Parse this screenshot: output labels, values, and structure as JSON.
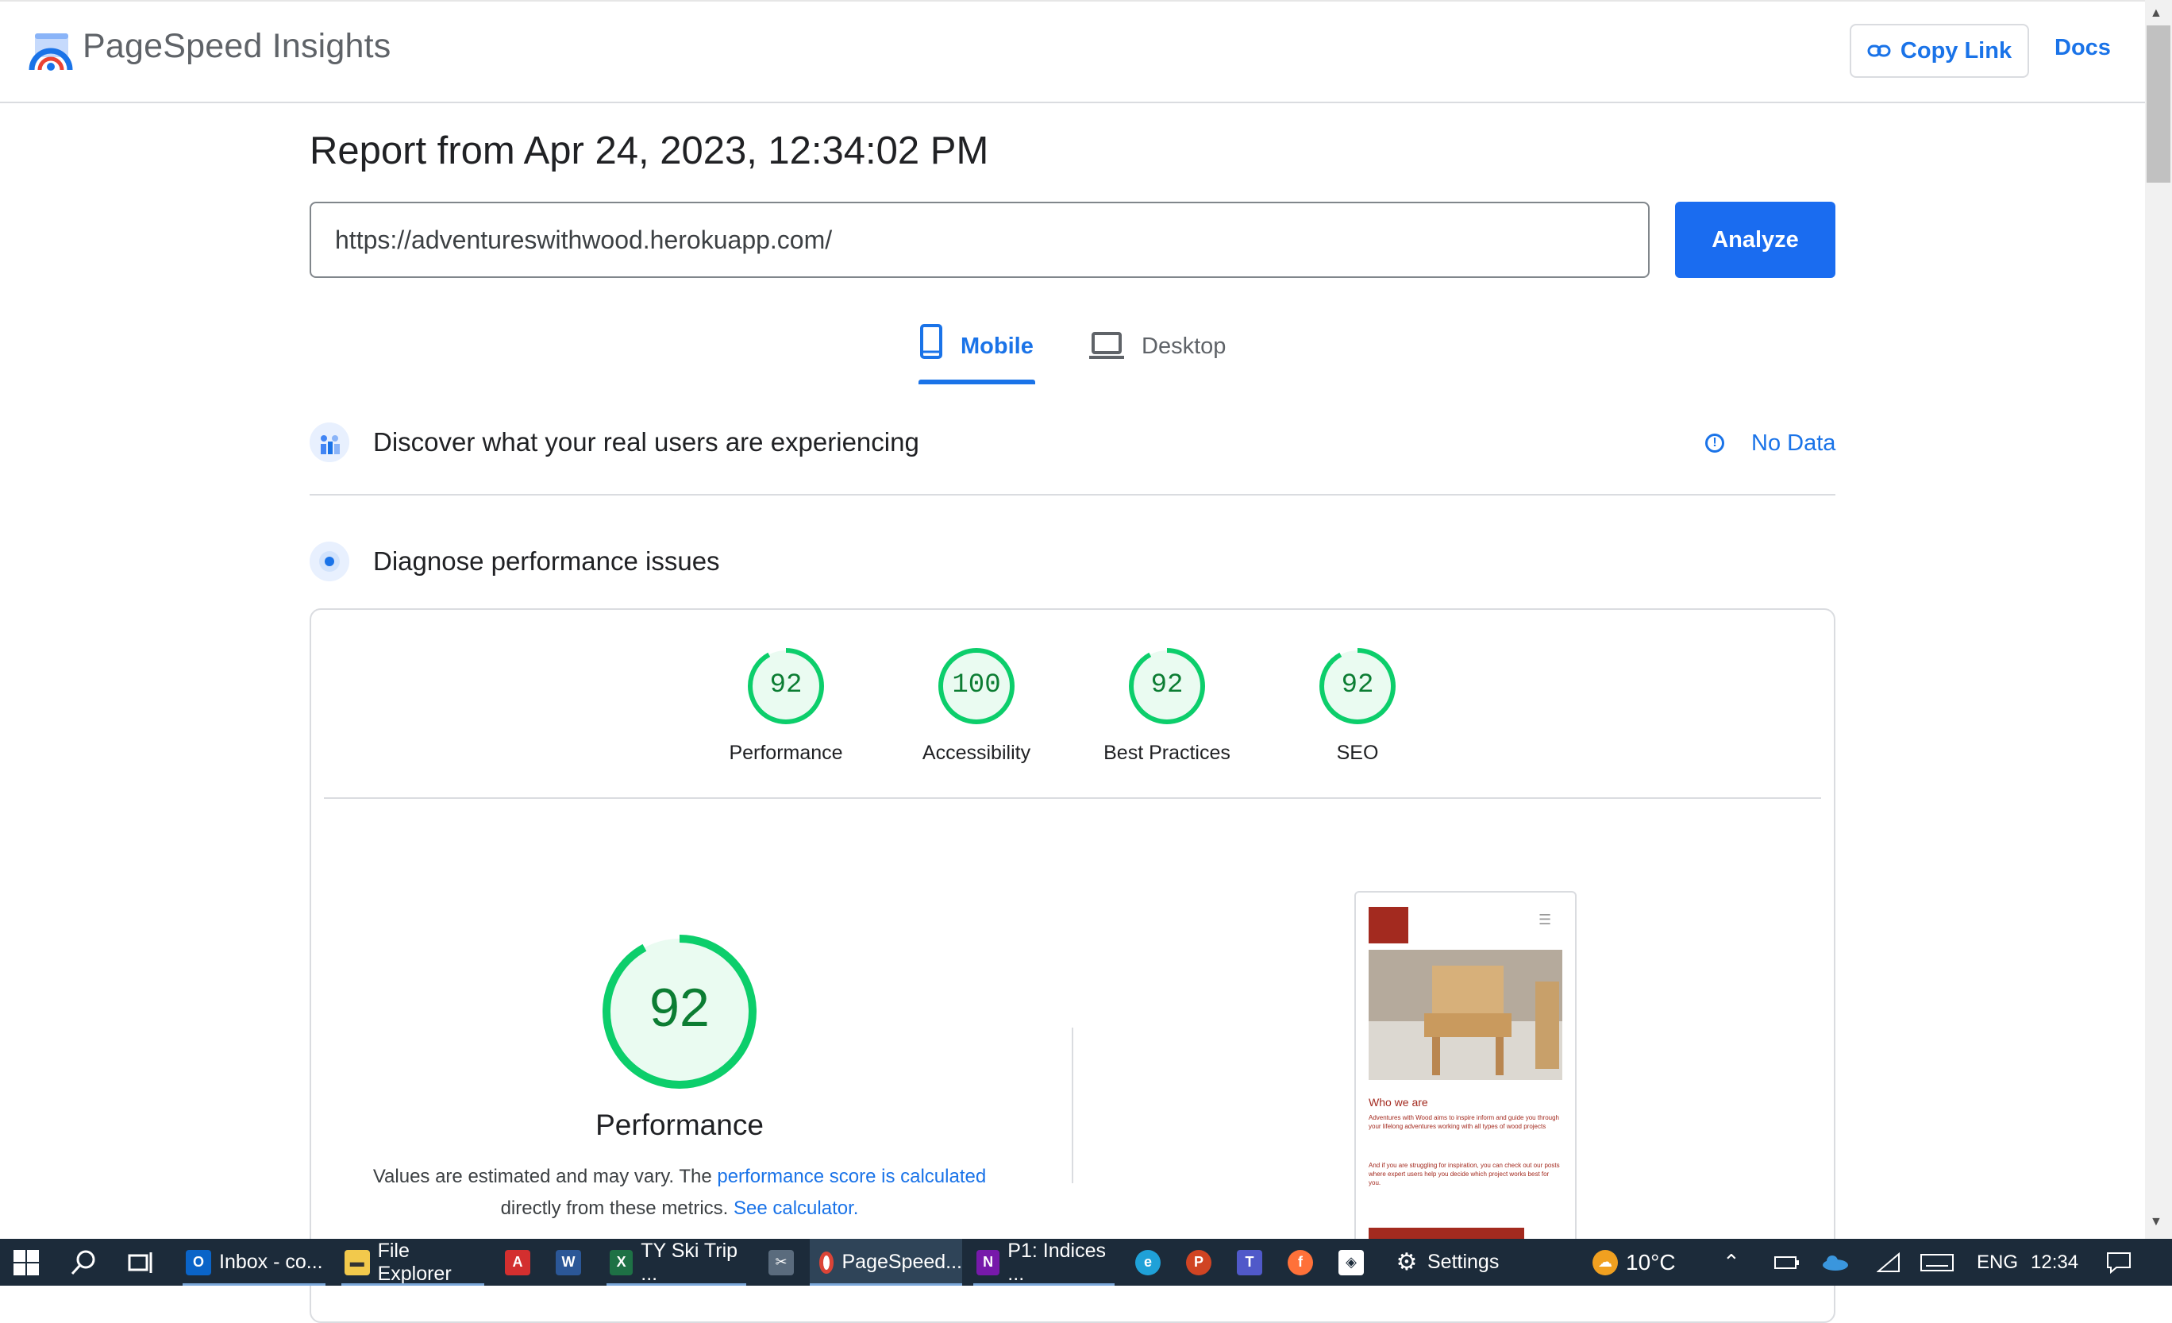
{
  "header": {
    "app_title": "PageSpeed Insights",
    "copy_link_label": "Copy Link",
    "docs_label": "Docs"
  },
  "report": {
    "title": "Report from Apr 24, 2023, 12:34:02 PM",
    "url_value": "https://adventureswithwood.herokuapp.com/",
    "analyze_label": "Analyze"
  },
  "tabs": [
    {
      "label": "Mobile",
      "selected": true
    },
    {
      "label": "Desktop",
      "selected": false
    }
  ],
  "field_data": {
    "title": "Discover what your real users are experiencing",
    "status": "No Data"
  },
  "diagnose": {
    "title": "Diagnose performance issues"
  },
  "scores": [
    {
      "label": "Performance",
      "score": "92",
      "fraction": 0.92
    },
    {
      "label": "Accessibility",
      "score": "100",
      "fraction": 1.0
    },
    {
      "label": "Best Practices",
      "score": "92",
      "fraction": 0.92
    },
    {
      "label": "SEO",
      "score": "92",
      "fraction": 0.92
    }
  ],
  "performance_detail": {
    "score": "92",
    "fraction": 0.92,
    "label": "Performance",
    "note_text_1": "Values are estimated and may vary. The ",
    "note_link_1": "performance score is calculated",
    "note_text_2": "directly from these metrics. ",
    "note_link_2": "See calculator."
  },
  "thumbnail": {
    "heading": "Who we are",
    "para1": "Adventures with Wood aims to inspire inform and guide you through your lifelong adventures working with all types of wood projects",
    "para2": "And if you are struggling for inspiration, you can check out our posts where expert users help you decide which project works best for you."
  },
  "colors": {
    "accent": "#1a73e8",
    "score_good": "#0cce6b",
    "score_text": "#0c7d33",
    "taskbar": "#1c2b3a"
  },
  "taskbar": {
    "items": [
      {
        "label": "Inbox - co...",
        "icon": "outlook-icon"
      },
      {
        "label": "File Explorer",
        "icon": "folder-icon"
      },
      {
        "label": "",
        "icon": "acrobat-icon"
      },
      {
        "label": "",
        "icon": "word-icon"
      },
      {
        "label": "TY Ski Trip ...",
        "icon": "excel-icon"
      },
      {
        "label": "",
        "icon": "snipping-icon"
      },
      {
        "label": "PageSpeed...",
        "icon": "chrome-icon"
      },
      {
        "label": "P1: Indices ...",
        "icon": "onenote-icon"
      },
      {
        "label": "",
        "icon": "edge-icon"
      },
      {
        "label": "",
        "icon": "powerpoint-icon"
      },
      {
        "label": "",
        "icon": "teams-icon"
      },
      {
        "label": "",
        "icon": "firefox-icon"
      },
      {
        "label": "",
        "icon": "app-icon"
      },
      {
        "label": "Settings",
        "icon": "gear-icon"
      }
    ],
    "weather": "10°C",
    "language": "ENG",
    "time": "12:34"
  }
}
